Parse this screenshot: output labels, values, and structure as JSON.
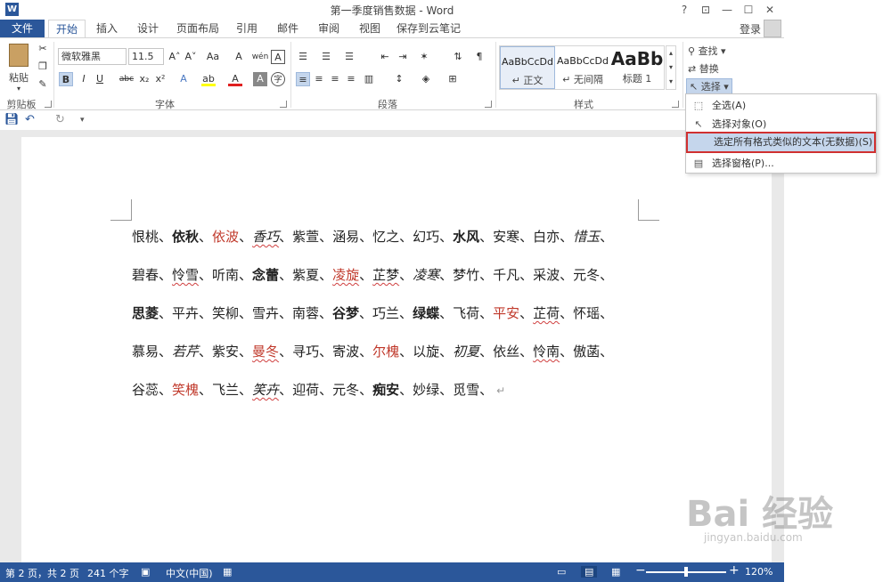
{
  "titlebar": {
    "app_icon": "W",
    "title": "第一季度销售数据 - Word",
    "help": "?",
    "restore_ribbon": "⊡",
    "minimize": "—",
    "maximize": "☐",
    "close": "✕"
  },
  "tabs": [
    "文件",
    "开始",
    "插入",
    "设计",
    "页面布局",
    "引用",
    "邮件",
    "审阅",
    "视图",
    "保存到云笔记"
  ],
  "login": "登录",
  "ribbon": {
    "clipboard": {
      "paste": "粘贴",
      "label": "剪贴板"
    },
    "font": {
      "family": "微软雅黑",
      "size": "11.5",
      "label": "字体",
      "grow": "A˄",
      "shrink": "A˅",
      "case": "Aa",
      "clear": "A",
      "phonetic": "wén",
      "border": "A",
      "bold": "B",
      "italic": "I",
      "underline": "U",
      "strike": "abc",
      "sub": "x₂",
      "sup": "x²",
      "effects": "A",
      "highlight": "ab",
      "color": "A",
      "shading": "A",
      "enclose": "字"
    },
    "paragraph": {
      "label": "段落"
    },
    "styles": {
      "label": "样式",
      "items": [
        {
          "sample": "AaBbCcDd",
          "name": "↵ 正文"
        },
        {
          "sample": "AaBbCcDd",
          "name": "↵ 无间隔"
        },
        {
          "sample": "AaBb",
          "name": "标题 1"
        }
      ]
    },
    "editing": {
      "find": "查找",
      "replace": "替换",
      "select": "选择"
    }
  },
  "menu": [
    {
      "label": "全选(A)",
      "icon": "select-all-icon",
      "highlight": false
    },
    {
      "label": "选择对象(O)",
      "icon": "arrow-icon",
      "highlight": false
    },
    {
      "label": "选定所有格式类似的文本(无数据)(S)",
      "icon": "",
      "highlight": true
    },
    {
      "label": "选择窗格(P)...",
      "icon": "pane-icon",
      "highlight": false
    }
  ],
  "document": {
    "lines": [
      [
        {
          "t": "恨桃、"
        },
        {
          "t": "依秋",
          "s": [
            "bold"
          ]
        },
        {
          "t": "、"
        },
        {
          "t": "依波",
          "s": [
            "red"
          ]
        },
        {
          "t": "、"
        },
        {
          "t": "香巧",
          "s": [
            "italic",
            "wavy"
          ]
        },
        {
          "t": "、紫萱、涵易、忆之、幻巧、"
        },
        {
          "t": "水风",
          "s": [
            "bold"
          ]
        },
        {
          "t": "、安寒、白亦、"
        },
        {
          "t": "惜玉",
          "s": [
            "italic"
          ]
        },
        {
          "t": "、"
        }
      ],
      [
        {
          "t": "碧春、"
        },
        {
          "t": "怜雪",
          "s": [
            "wavy"
          ]
        },
        {
          "t": "、听南、"
        },
        {
          "t": "念蕾",
          "s": [
            "bold"
          ]
        },
        {
          "t": "、紫夏、"
        },
        {
          "t": "凌旋",
          "s": [
            "red",
            "wavy"
          ]
        },
        {
          "t": "、"
        },
        {
          "t": "芷梦",
          "s": [
            "wavy"
          ]
        },
        {
          "t": "、"
        },
        {
          "t": "凌寒",
          "s": [
            "italic"
          ]
        },
        {
          "t": "、梦竹、千凡、采波、元冬、"
        }
      ],
      [
        {
          "t": "思菱",
          "s": [
            "bold"
          ]
        },
        {
          "t": "、平卉、笑柳、雪卉、南蓉、"
        },
        {
          "t": "谷梦",
          "s": [
            "bold"
          ]
        },
        {
          "t": "、巧兰、"
        },
        {
          "t": "绿蝶",
          "s": [
            "bold"
          ]
        },
        {
          "t": "、飞荷、"
        },
        {
          "t": "平安",
          "s": [
            "red"
          ]
        },
        {
          "t": "、"
        },
        {
          "t": "芷荷",
          "s": [
            "wavy"
          ]
        },
        {
          "t": "、怀瑶、"
        }
      ],
      [
        {
          "t": "慕易、"
        },
        {
          "t": "若芹",
          "s": [
            "italic"
          ]
        },
        {
          "t": "、紫安、"
        },
        {
          "t": "曼冬",
          "s": [
            "red",
            "wavy"
          ]
        },
        {
          "t": "、寻巧、寄波、"
        },
        {
          "t": "尔槐",
          "s": [
            "red"
          ]
        },
        {
          "t": "、以旋、"
        },
        {
          "t": "初夏",
          "s": [
            "italic"
          ]
        },
        {
          "t": "、依丝、"
        },
        {
          "t": "怜南",
          "s": [
            "wavy"
          ]
        },
        {
          "t": "、傲菡、"
        }
      ],
      [
        {
          "t": "谷蕊、"
        },
        {
          "t": "笑槐",
          "s": [
            "red"
          ]
        },
        {
          "t": "、飞兰、"
        },
        {
          "t": "笑卉",
          "s": [
            "italic",
            "wavy"
          ]
        },
        {
          "t": "、迎荷、元冬、"
        },
        {
          "t": "痴安",
          "s": [
            "bold"
          ]
        },
        {
          "t": "、妙绿、觅雪、"
        }
      ]
    ],
    "para_mark": "↵"
  },
  "status": {
    "page": "第 2 页，共 2 页",
    "words": "241 个字",
    "lang": "中文(中国)",
    "zoom": "120%",
    "minus": "−",
    "plus": "+"
  },
  "watermark": {
    "brand": "Bai 经验",
    "url": "jingyan.baidu.com"
  },
  "colors": {
    "accent": "#2b579a",
    "red_text": "#c0392b",
    "highlight_border": "#d03030"
  }
}
